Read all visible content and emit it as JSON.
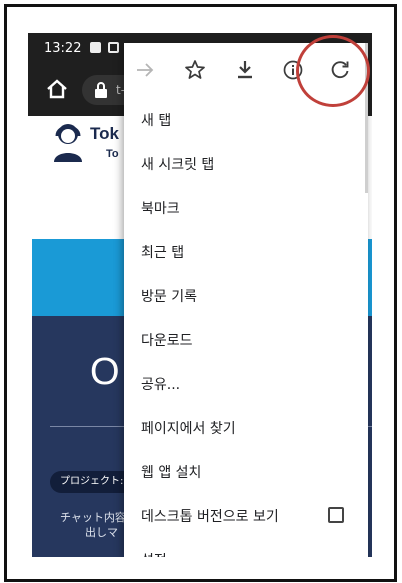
{
  "status_bar": {
    "time": "13:22"
  },
  "browser": {
    "url_partial": "t-"
  },
  "site": {
    "logo_line1": "Tok",
    "logo_line2": "To",
    "hero_big": "O",
    "project_pill": "プロジェクト:",
    "chat_line1": "チャット内容",
    "chat_line2": "出しマ"
  },
  "menu": {
    "toolbar": [
      "forward-icon",
      "star-icon",
      "download-icon",
      "info-icon",
      "reload-icon"
    ],
    "items": [
      {
        "label": "새 탭"
      },
      {
        "label": "새 시크릿 탭"
      },
      {
        "label": "북마크"
      },
      {
        "label": "최근 탭"
      },
      {
        "label": "방문 기록"
      },
      {
        "label": "다운로드"
      },
      {
        "label": "공유..."
      },
      {
        "label": "페이지에서 찾기"
      },
      {
        "label": "웹 앱 설치"
      },
      {
        "label": "데스크톱 버전으로 보기",
        "checked": false
      },
      {
        "label": "설정"
      }
    ]
  },
  "annotation": {
    "color": "#c0403a"
  }
}
